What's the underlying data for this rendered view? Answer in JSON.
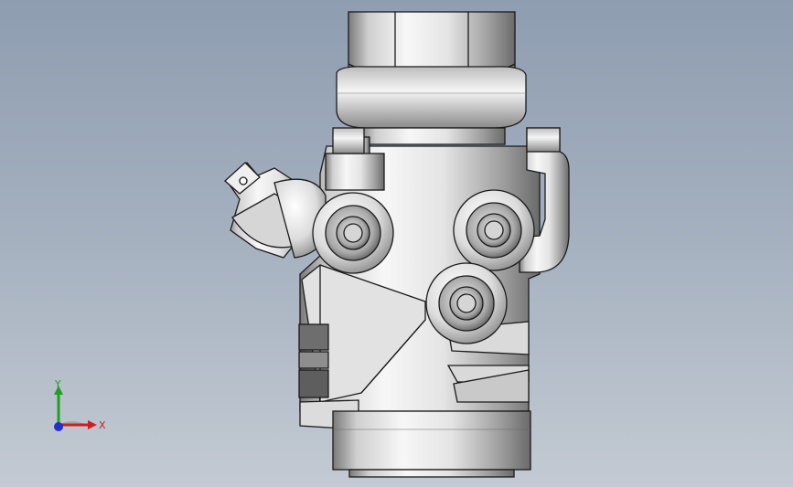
{
  "viewport": {
    "background_top": "#8f9db1",
    "background_bottom": "#c3cad3"
  },
  "model": {
    "name": "valve-body-assembly",
    "render_style": "shaded-with-edges"
  },
  "triad": {
    "x_label": "X",
    "y_label": "Y",
    "x_color": "#cc2020",
    "y_color": "#20a020",
    "z_color": "#2030d0"
  }
}
